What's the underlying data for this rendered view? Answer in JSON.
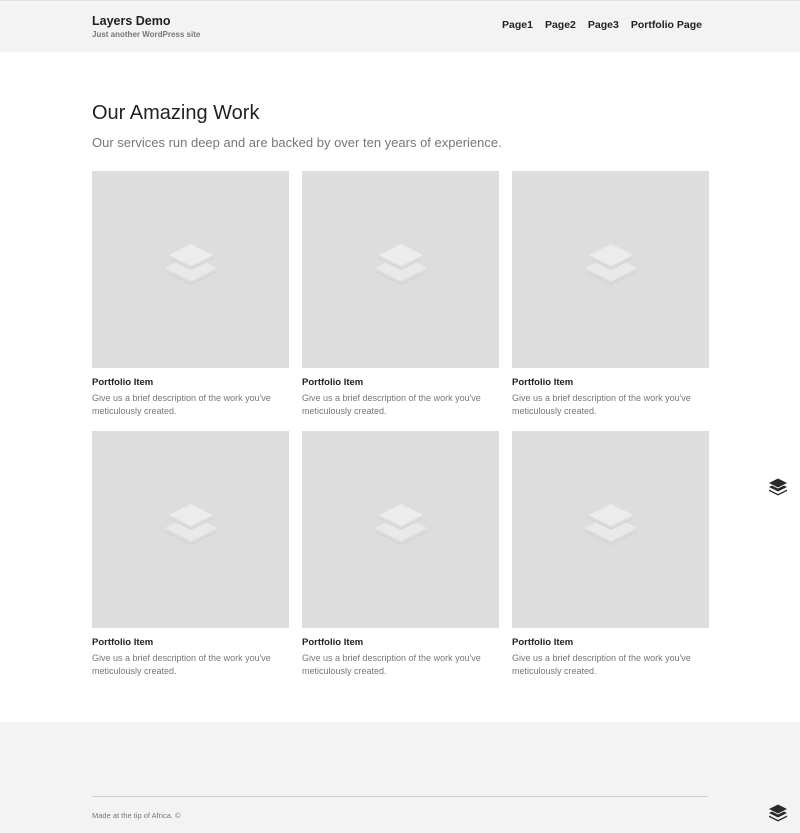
{
  "header": {
    "site_title": "Layers Demo",
    "tagline": "Just another WordPress site",
    "nav": [
      "Page1",
      "Page2",
      "Page3",
      "Portfolio Page"
    ]
  },
  "portfolio": {
    "title": "Our Amazing Work",
    "excerpt": "Our services run deep and are backed by over ten years of experience.",
    "items": [
      {
        "title": "Portfolio Item",
        "excerpt": "Give us a brief description of the work you've meticulously created."
      },
      {
        "title": "Portfolio Item",
        "excerpt": "Give us a brief description of the work you've meticulously created."
      },
      {
        "title": "Portfolio Item",
        "excerpt": "Give us a brief description of the work you've meticulously created."
      },
      {
        "title": "Portfolio Item",
        "excerpt": "Give us a brief description of the work you've meticulously created."
      },
      {
        "title": "Portfolio Item",
        "excerpt": "Give us a brief description of the work you've meticulously created."
      },
      {
        "title": "Portfolio Item",
        "excerpt": "Give us a brief description of the work you've meticulously created."
      }
    ]
  },
  "footer": {
    "copyright": "Made at the tip of Africa. ©"
  },
  "icons": {
    "placeholder": "layers-icon",
    "side_widget": "layers-icon"
  },
  "colors": {
    "header_bg": "#f3f3f3",
    "thumb_bg": "#dddddd",
    "muted_text": "#777777"
  }
}
